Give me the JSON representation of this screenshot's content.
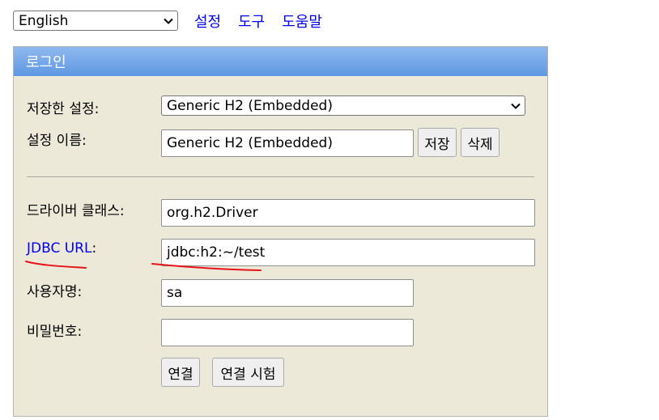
{
  "top": {
    "language": "English",
    "links": [
      "설정",
      "도구",
      "도움말"
    ]
  },
  "login": {
    "header": "로그인",
    "saved_settings_label": "저장한 설정:",
    "saved_settings_value": "Generic H2 (Embedded)",
    "setting_name_label": "설정 이름:",
    "setting_name_value": "Generic H2 (Embedded)",
    "save_button": "저장",
    "delete_button": "삭제",
    "driver_class_label": "드라이버 클래스:",
    "driver_class_value": "org.h2.Driver",
    "jdbc_url_link": "JDBC URL",
    "jdbc_url_colon": ":",
    "jdbc_url_value": "jdbc:h2:~/test",
    "username_label": "사용자명:",
    "username_value": "sa",
    "password_label": "비밀번호:",
    "password_value": "",
    "connect_button": "연결",
    "test_connection_button": "연결 시험"
  },
  "colors": {
    "header_gradient_top": "#8fb9ee",
    "header_gradient_bottom": "#5f97e2",
    "panel_background": "#ece9d8",
    "link": "#0000ee",
    "annotation_underline": "#e8141c"
  },
  "icons": {
    "dropdown": "chevron-down-icon"
  }
}
